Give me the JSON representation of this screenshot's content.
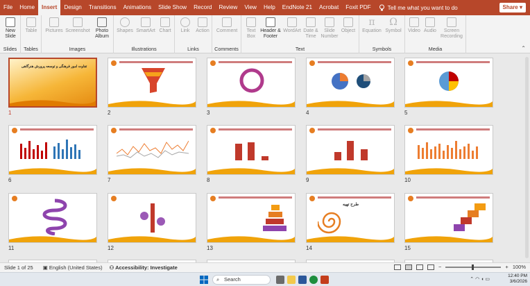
{
  "menubar": {
    "tabs": [
      "File",
      "Home",
      "Insert",
      "Design",
      "Transitions",
      "Animations",
      "Slide Show",
      "Record",
      "Review",
      "View",
      "Help",
      "EndNote 21",
      "Acrobat",
      "Foxit PDF"
    ],
    "active_tab": "Insert",
    "search_placeholder": "Tell me what you want to do",
    "share_label": "Share"
  },
  "ribbon": {
    "groups": {
      "slides": "Slides",
      "tables": "Tables",
      "images": "Images",
      "illustrations": "Illustrations",
      "links": "Links",
      "comments": "Comments",
      "text": "Text",
      "symbols": "Symbols",
      "media": "Media"
    },
    "buttons": {
      "new_slide": "New Slide",
      "table": "Table",
      "pictures": "Pictures",
      "screenshot": "Screenshot",
      "photo_album": "Photo Album",
      "shapes": "Shapes",
      "smartart": "SmartArt",
      "chart": "Chart",
      "link": "Link",
      "action": "Action",
      "comment": "Comment",
      "text_box": "Text Box",
      "header_footer": "Header & Footer",
      "wordart": "WordArt",
      "date_time": "Date & Time",
      "slide_number": "Slide Number",
      "object": "Object",
      "equation": "Equation",
      "symbol": "Symbol",
      "video": "Video",
      "audio": "Audio",
      "screen_recording": "Screen Recording"
    }
  },
  "slides": [
    {
      "n": "1",
      "title": "تفاوت امور فرهنگی و توسعه پرورش هنرگاهی"
    },
    {
      "n": "2"
    },
    {
      "n": "3"
    },
    {
      "n": "4"
    },
    {
      "n": "5"
    },
    {
      "n": "6"
    },
    {
      "n": "7"
    },
    {
      "n": "8"
    },
    {
      "n": "9"
    },
    {
      "n": "10"
    },
    {
      "n": "11"
    },
    {
      "n": "12"
    },
    {
      "n": "13"
    },
    {
      "n": "14"
    },
    {
      "n": "15"
    }
  ],
  "slide14_title": "طرح تهیه",
  "status": {
    "slide_of": "Slide 1 of 25",
    "language": "English (United States)",
    "accessibility": "Accessibility: Investigate",
    "zoom": "100%"
  },
  "taskbar": {
    "search": "Search",
    "time": "12:40 PM",
    "date": "3/6/2026"
  },
  "colors": {
    "accent": "#b7472a",
    "wave": "#f0a30a",
    "selection": "#c0392b"
  }
}
